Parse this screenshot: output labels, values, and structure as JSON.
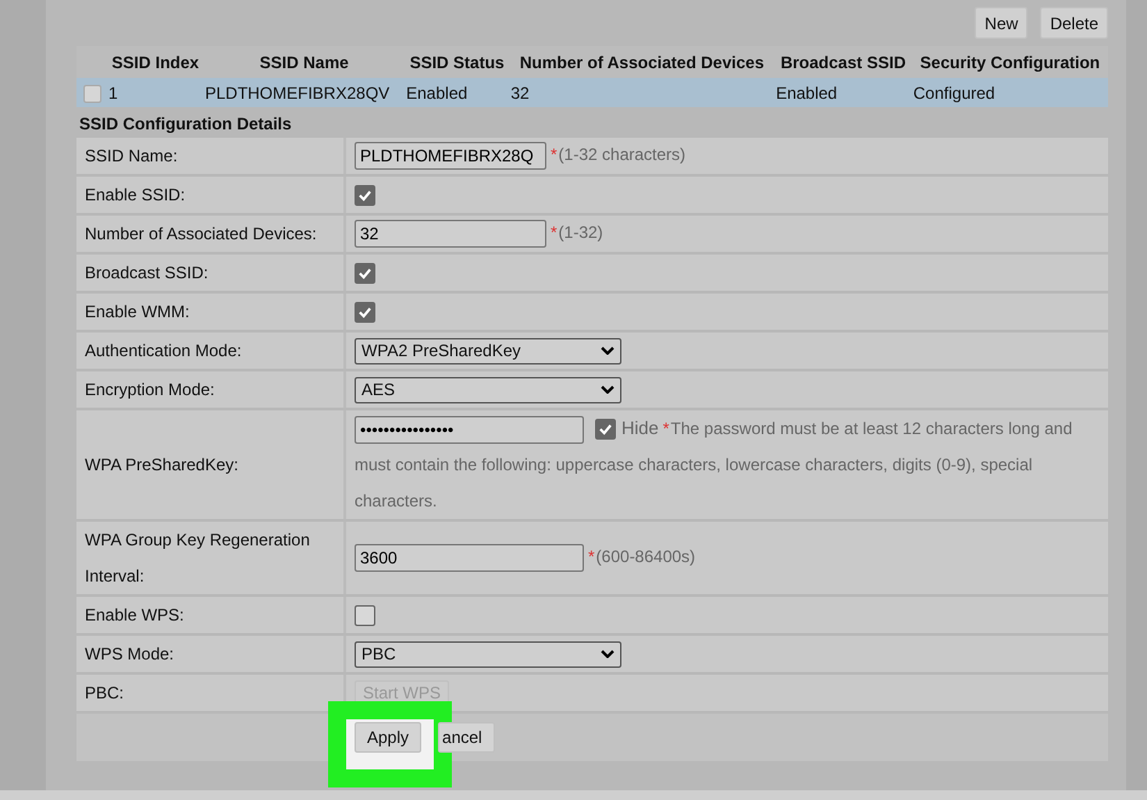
{
  "toolbar": {
    "buttons": [
      "New",
      "Delete"
    ]
  },
  "ssid_table": {
    "columns": [
      "SSID Index",
      "SSID Name",
      "SSID Status",
      "Number of Associated Devices",
      "Broadcast SSID",
      "Security Configuration"
    ],
    "rows": [
      {
        "checked": false,
        "selected": true,
        "cells": [
          "1",
          "PLDTHOMEFIBRX28QV",
          "Enabled",
          "32",
          "Enabled",
          "Configured"
        ]
      }
    ]
  },
  "section_title": "SSID Configuration Details",
  "form": {
    "rows": [
      {
        "kind": "text",
        "label": "SSID Name:",
        "value": "PLDTHOMEFIBRX28Q",
        "mark": "*",
        "hint": "(1-32 characters)"
      },
      {
        "kind": "checkbox",
        "label": "Enable SSID:",
        "checked": true
      },
      {
        "kind": "text",
        "label": "Number of Associated Devices:",
        "value": "32",
        "mark": "*",
        "hint": "(1-32)"
      },
      {
        "kind": "checkbox",
        "label": "Broadcast SSID:",
        "checked": true
      },
      {
        "kind": "checkbox",
        "label": "Enable WMM:",
        "checked": true
      },
      {
        "kind": "select",
        "label": "Authentication Mode:",
        "value": "WPA2 PreSharedKey"
      },
      {
        "kind": "select",
        "label": "Encryption Mode:",
        "value": "AES"
      },
      {
        "kind": "password",
        "label": "WPA PreSharedKey:",
        "value": "••••••••••••••••",
        "hide_label": "Hide",
        "hide_checked": true,
        "mark": "*",
        "hint": "The password must be at least 12 characters long and",
        "hint_continued": "must contain the following: uppercase characters, lowercase characters, digits (0-9), special characters."
      },
      {
        "kind": "text",
        "label": "WPA Group Key Regeneration Interval:",
        "value": "3600",
        "mark": "*",
        "hint": "(600-86400s)"
      },
      {
        "kind": "checkbox",
        "label": "Enable WPS:",
        "checked": false
      },
      {
        "kind": "select",
        "label": "WPS Mode:",
        "value": "PBC"
      },
      {
        "kind": "button",
        "label": "PBC:",
        "button_label": "Start WPS",
        "disabled": true
      }
    ]
  },
  "footer_buttons": [
    {
      "label": "Apply",
      "highlighted": true
    },
    {
      "label": "ancel",
      "highlighted": false
    }
  ]
}
